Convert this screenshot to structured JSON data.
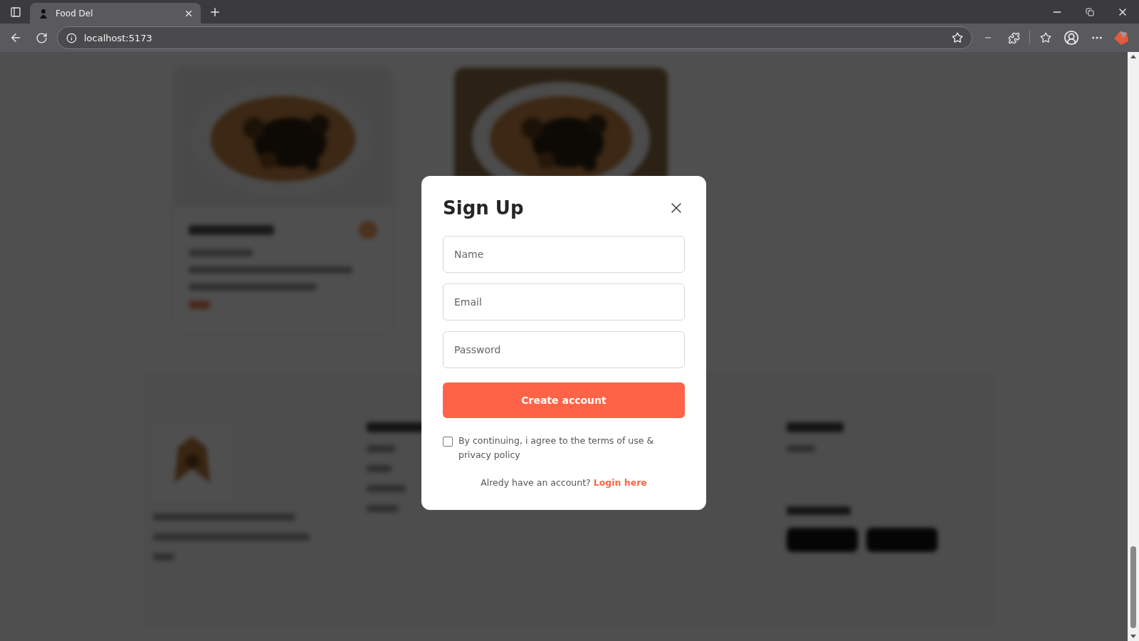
{
  "browser": {
    "tab_title": "Food Del",
    "url": "localhost:5173"
  },
  "modal": {
    "title": "Sign Up",
    "fields": [
      {
        "placeholder": "Name"
      },
      {
        "placeholder": "Email"
      },
      {
        "placeholder": "Password"
      }
    ],
    "submit": "Create account",
    "terms": {
      "checked": false,
      "text": "By continuing, i agree to the terms of use & privacy policy"
    },
    "switch_prompt": "Alredy have an account?",
    "switch_link": "Login here"
  }
}
